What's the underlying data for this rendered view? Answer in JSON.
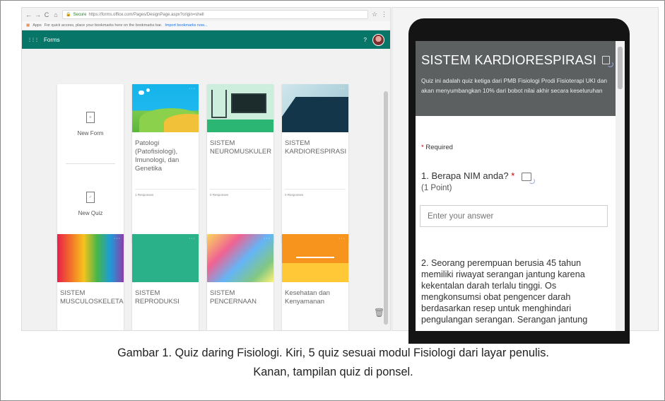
{
  "browser": {
    "nav_back": "←",
    "nav_forward": "→",
    "nav_reload": "C",
    "nav_home": "⌂",
    "secure_label": "Secure",
    "url": "https://forms.office.com/Pages/DesignPage.aspx?origin=shell",
    "star": "☆",
    "menu": "⋮",
    "apps_label": "Apps",
    "bookmarks_hint": "For quick access, place your bookmarks here on the bookmarks bar.",
    "bookmarks_link": "Import bookmarks now..."
  },
  "forms_app": {
    "waffle": "⋮⋮⋮",
    "title": "Forms",
    "help": "?",
    "new_form_label": "New Form",
    "new_quiz_label": "New Quiz",
    "cards": [
      {
        "title": "Patologi (Patofisiologi), Imunologi, dan Genetika",
        "responses": "1 Responses"
      },
      {
        "title": "SISTEM NEUROMUSKULER",
        "responses": "0 Responses"
      },
      {
        "title": "SISTEM KARDIORESPIRASI",
        "responses": "0 Responses"
      },
      {
        "title": "SISTEM MUSCULOSKELETAL",
        "responses": ""
      },
      {
        "title": "SISTEM REPRODUKSI",
        "responses": ""
      },
      {
        "title": "SISTEM PENCERNAAN",
        "responses": ""
      },
      {
        "title": "Kesehatan dan Kenyamanan",
        "responses": ""
      }
    ],
    "ellipsis": "···"
  },
  "phone_form": {
    "title": "SISTEM KARDIORESPIRASI",
    "description": "Quiz ini adalah quiz ketiga dari PMB Fisiologi Prodi Fisioterapi UKI dan akan menyumbangkan 10% dari bobot nilai akhir secara keseluruhan",
    "required_star": "*",
    "required_label": "Required",
    "q1_text": "1. Berapa NIM anda?",
    "q1_star": "*",
    "q1_points": "(1 Point)",
    "answer_placeholder": "Enter your answer",
    "q2_text": "2. Seorang perempuan berusia 45 tahun memiliki riwayat serangan jantung karena kekentalan darah terlalu tinggi. Os mengkonsumsi obat pengencer darah berdasarkan resep untuk menghindari pengulangan serangan. Serangan jantung"
  },
  "caption": {
    "line1": "Gambar 1. Quiz daring Fisiologi. Kiri, 5 quiz sesuai modul Fisiologi dari layar penulis.",
    "line2": "Kanan, tampilan quiz di ponsel."
  },
  "colors": {
    "forms_green": "#077568",
    "form_header_gray": "#5c6061",
    "required_red": "#cc0000"
  }
}
